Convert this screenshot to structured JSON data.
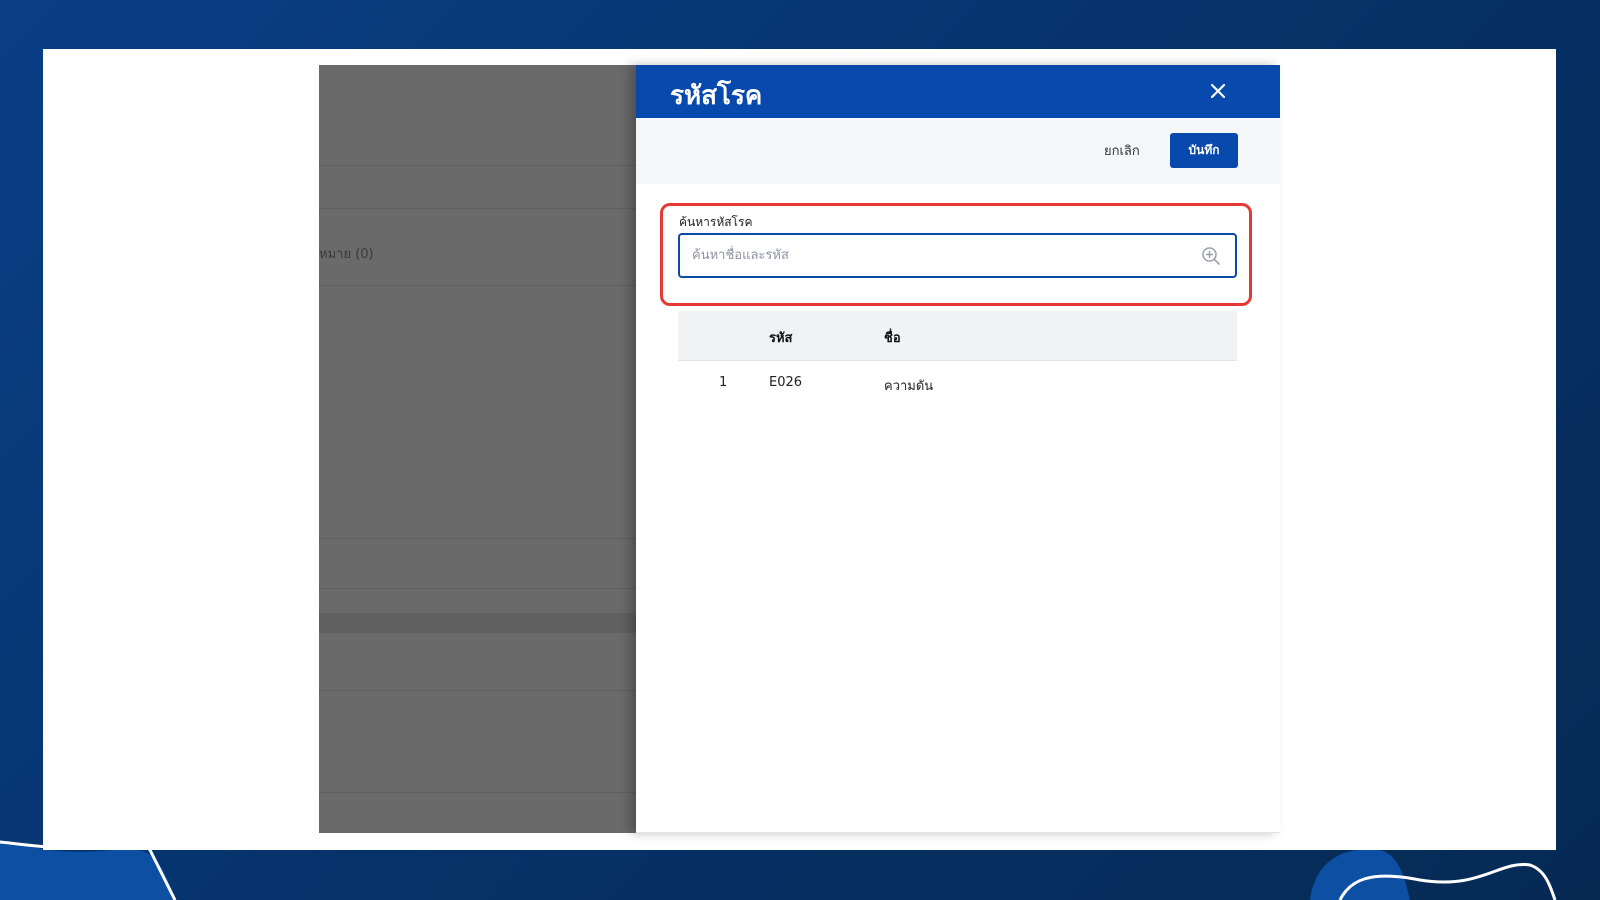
{
  "background_app": {
    "tab_label": "หมาย (0)"
  },
  "drawer": {
    "title": "รหัสโรค",
    "close_icon": "close-icon",
    "toolbar": {
      "cancel_label": "ยกเลิก",
      "save_label": "บันทึก"
    },
    "search": {
      "label": "ค้นหารหัสโรค",
      "placeholder": "ค้นหาชื่อและรหัส",
      "value": "",
      "icon": "zoom-in-icon"
    },
    "table": {
      "columns": [
        "",
        "รหัส",
        "ชื่อ"
      ],
      "rows": [
        {
          "no": "1",
          "code": "E026",
          "name": "ความดัน"
        }
      ]
    }
  },
  "colors": {
    "header_blue": "#0749ad",
    "highlight_red": "#e53935",
    "overlay_gray": "#6a6a6a",
    "page_background": "#06336c"
  }
}
